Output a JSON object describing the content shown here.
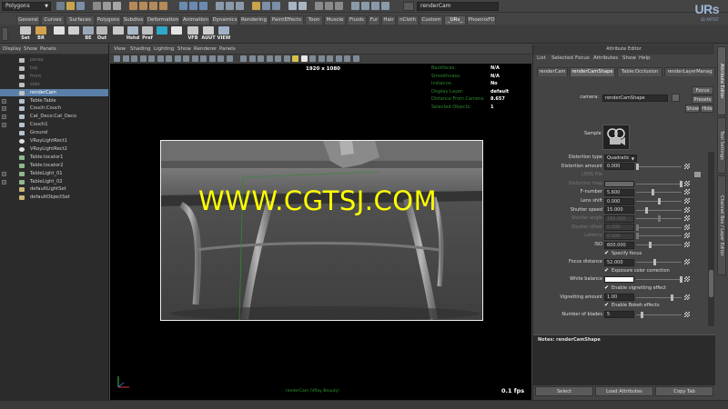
{
  "statusline": {
    "mode": "Polygons",
    "camera_field": "renderCam",
    "logo": "URs",
    "logo_sub": "3D ARTIST"
  },
  "shelf_tabs": [
    "General",
    "Curves",
    "Surfaces",
    "Polygons",
    "Subdivs",
    "Deformation",
    "Animation",
    "Dynamics",
    "Rendering",
    "PaintEffects",
    "Toon",
    "Muscle",
    "Fluids",
    "Fur",
    "Hair",
    "nCloth",
    "Custom",
    "_URs_",
    "PhoenixFD"
  ],
  "active_shelf_tab": "_URs_",
  "shelf_buttons": [
    "Set",
    "BR",
    "",
    "",
    "BE",
    "Out",
    "",
    "Hshd",
    "Pref",
    "",
    "",
    "VFB",
    "AUUT",
    "VIEW"
  ],
  "outliner": {
    "menu": [
      "Display",
      "Show",
      "Panels"
    ],
    "items": [
      {
        "name": "persp",
        "dim": true,
        "expand": false,
        "icon": "camera-icon"
      },
      {
        "name": "top",
        "dim": true,
        "expand": false,
        "icon": "camera-icon"
      },
      {
        "name": "front",
        "dim": true,
        "expand": false,
        "icon": "camera-icon"
      },
      {
        "name": "side",
        "dim": true,
        "expand": false,
        "icon": "camera-icon"
      },
      {
        "name": "renderCam",
        "dim": false,
        "expand": false,
        "icon": "camera-icon",
        "selected": true
      },
      {
        "name": "Table:Table",
        "dim": false,
        "expand": true,
        "icon": "mesh-icon"
      },
      {
        "name": "Couch:Couch",
        "dim": false,
        "expand": true,
        "icon": "mesh-icon"
      },
      {
        "name": "Cat_Deco:Cat_Deco",
        "dim": false,
        "expand": true,
        "icon": "mesh-icon"
      },
      {
        "name": "Couch1",
        "dim": false,
        "expand": true,
        "icon": "mesh-icon"
      },
      {
        "name": "Ground",
        "dim": false,
        "expand": false,
        "icon": "mesh-icon"
      },
      {
        "name": "VRayLightRect1",
        "dim": false,
        "expand": false,
        "icon": "light-icon"
      },
      {
        "name": "VRayLightRect2",
        "dim": false,
        "expand": false,
        "icon": "light-icon"
      },
      {
        "name": "Table:locator1",
        "dim": false,
        "expand": false,
        "icon": "locator-icon"
      },
      {
        "name": "Table:locator2",
        "dim": false,
        "expand": false,
        "icon": "locator-icon"
      },
      {
        "name": "TableLight_01",
        "dim": false,
        "expand": true,
        "icon": "locator-icon"
      },
      {
        "name": "TableLight_02",
        "dim": false,
        "expand": true,
        "icon": "locator-icon"
      },
      {
        "name": "defaultLightSet",
        "dim": false,
        "expand": false,
        "icon": "set-icon"
      },
      {
        "name": "defaultObjectSet",
        "dim": false,
        "expand": false,
        "icon": "set-icon"
      }
    ]
  },
  "viewport": {
    "menu": [
      "View",
      "Shading",
      "Lighting",
      "Show",
      "Renderer",
      "Panels"
    ],
    "resolution": "1920 x 1080",
    "hud": [
      {
        "key": "Backfaces:",
        "value": "N/A"
      },
      {
        "key": "Smoothness:",
        "value": "N/A"
      },
      {
        "key": "Instance:",
        "value": "No"
      },
      {
        "key": "Display Layer:",
        "value": "default"
      },
      {
        "key": "Distance From Camera:",
        "value": "8.657"
      },
      {
        "key": "Selected Objects:",
        "value": "1"
      }
    ],
    "watermark": "WWW.CGTSJ.COM",
    "camera_name": "renderCam (VRay Beauty)",
    "fps": "0.1 fps"
  },
  "attribute_editor": {
    "title": "Attribute Editor",
    "menu": [
      "List",
      "Selected",
      "Focus",
      "Attributes",
      "Show",
      "Help"
    ],
    "tabs": [
      "renderCam",
      "renderCamShape",
      "Table:Occlusion",
      "renderLayerManag"
    ],
    "active_tab": "renderCamShape",
    "camera_label": "camera:",
    "camera_value": "renderCamShape",
    "focus_btn": "Focus",
    "presets_btn": "Presets",
    "show_btn": "Show",
    "hide_btn": "Hide",
    "sample_label": "Sample",
    "rows": [
      {
        "type": "dropdown",
        "label": "Distortion type",
        "value": "Quadratic"
      },
      {
        "type": "slider",
        "label": "Distortion amount",
        "value": "0.000",
        "knob": 0.0,
        "map": true
      },
      {
        "type": "file",
        "label": "LENS File",
        "disabled": true
      },
      {
        "type": "color",
        "label": "Distortion map",
        "disabled": true,
        "map": true
      },
      {
        "type": "slider",
        "label": "F-number",
        "value": "5.600",
        "knob": 0.35,
        "map": true
      },
      {
        "type": "slider",
        "label": "Lens shift",
        "value": "0.000",
        "knob": 0.5,
        "map": true
      },
      {
        "type": "slider",
        "label": "Shutter speed",
        "value": "15.000",
        "knob": 0.2,
        "map": true
      },
      {
        "type": "slider",
        "label": "Shutter angle",
        "value": "180.000",
        "knob": 0.5,
        "disabled": true,
        "map": true
      },
      {
        "type": "slider",
        "label": "Shutter offset",
        "value": "0.000",
        "knob": 0.0,
        "disabled": true,
        "map": true
      },
      {
        "type": "slider",
        "label": "Latency",
        "value": "0.000",
        "knob": 0.0,
        "disabled": true,
        "map": true
      },
      {
        "type": "slider",
        "label": "ISO",
        "value": "600.000",
        "knob": 0.3,
        "map": true
      },
      {
        "type": "check",
        "label": "Specify focus"
      },
      {
        "type": "slider",
        "label": "Focus distance",
        "value": "52.000",
        "knob": 0.4,
        "map": true
      },
      {
        "type": "check",
        "label": "Exposure color correction"
      },
      {
        "type": "white",
        "label": "White balance",
        "map": true
      },
      {
        "type": "check",
        "label": "Enable vignetting effect"
      },
      {
        "type": "slider",
        "label": "Vignetting amount",
        "value": "1.00",
        "knob": 0.8,
        "map": true
      },
      {
        "type": "check",
        "label": "Enable Bokeh effects"
      },
      {
        "type": "slider",
        "label": "Number of blades",
        "value": "5",
        "knob": 0.1,
        "map": true
      }
    ],
    "notes_label": "Notes: renderCamShape",
    "bottom_buttons": [
      "Select",
      "Load Attributes",
      "Copy Tab"
    ]
  },
  "right_tabs": [
    "Attribute Editor",
    "Tool Settings",
    "Channel Box / Layer Editor"
  ]
}
